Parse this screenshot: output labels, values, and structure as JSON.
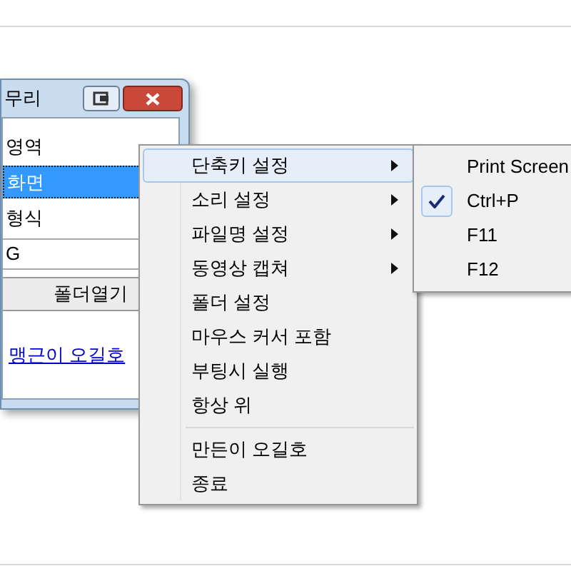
{
  "window": {
    "title": "무리",
    "list": [
      {
        "label": "영역",
        "selected": false
      },
      {
        "label": "화면",
        "selected": true
      },
      {
        "label": "형식",
        "selected": false
      }
    ],
    "format_value": "G",
    "folder_button": "폴더열기",
    "author_link": "맹근이 오길호"
  },
  "menu": {
    "items": [
      {
        "label": "단축키 설정",
        "submenu": true,
        "selected": true,
        "separator_above": false
      },
      {
        "label": "소리 설정",
        "submenu": true,
        "selected": false,
        "separator_above": false
      },
      {
        "label": "파일명 설정",
        "submenu": true,
        "selected": false,
        "separator_above": false
      },
      {
        "label": "동영상 캡쳐",
        "submenu": true,
        "selected": false,
        "separator_above": false
      },
      {
        "label": "폴더 설정",
        "submenu": false,
        "selected": false,
        "separator_above": false
      },
      {
        "label": "마우스 커서 포함",
        "submenu": false,
        "selected": false,
        "separator_above": false
      },
      {
        "label": "부팅시 실행",
        "submenu": false,
        "selected": false,
        "separator_above": false
      },
      {
        "label": "항상 위",
        "submenu": false,
        "selected": false,
        "separator_above": false
      },
      {
        "label": "만든이 오길호",
        "submenu": false,
        "selected": false,
        "separator_above": true
      },
      {
        "label": "종료",
        "submenu": false,
        "selected": false,
        "separator_above": false
      }
    ]
  },
  "submenu": {
    "items": [
      {
        "label": "Print Screen",
        "checked": false
      },
      {
        "label": "Ctrl+P",
        "checked": true
      },
      {
        "label": "F11",
        "checked": false
      },
      {
        "label": "F12",
        "checked": false
      }
    ]
  }
}
